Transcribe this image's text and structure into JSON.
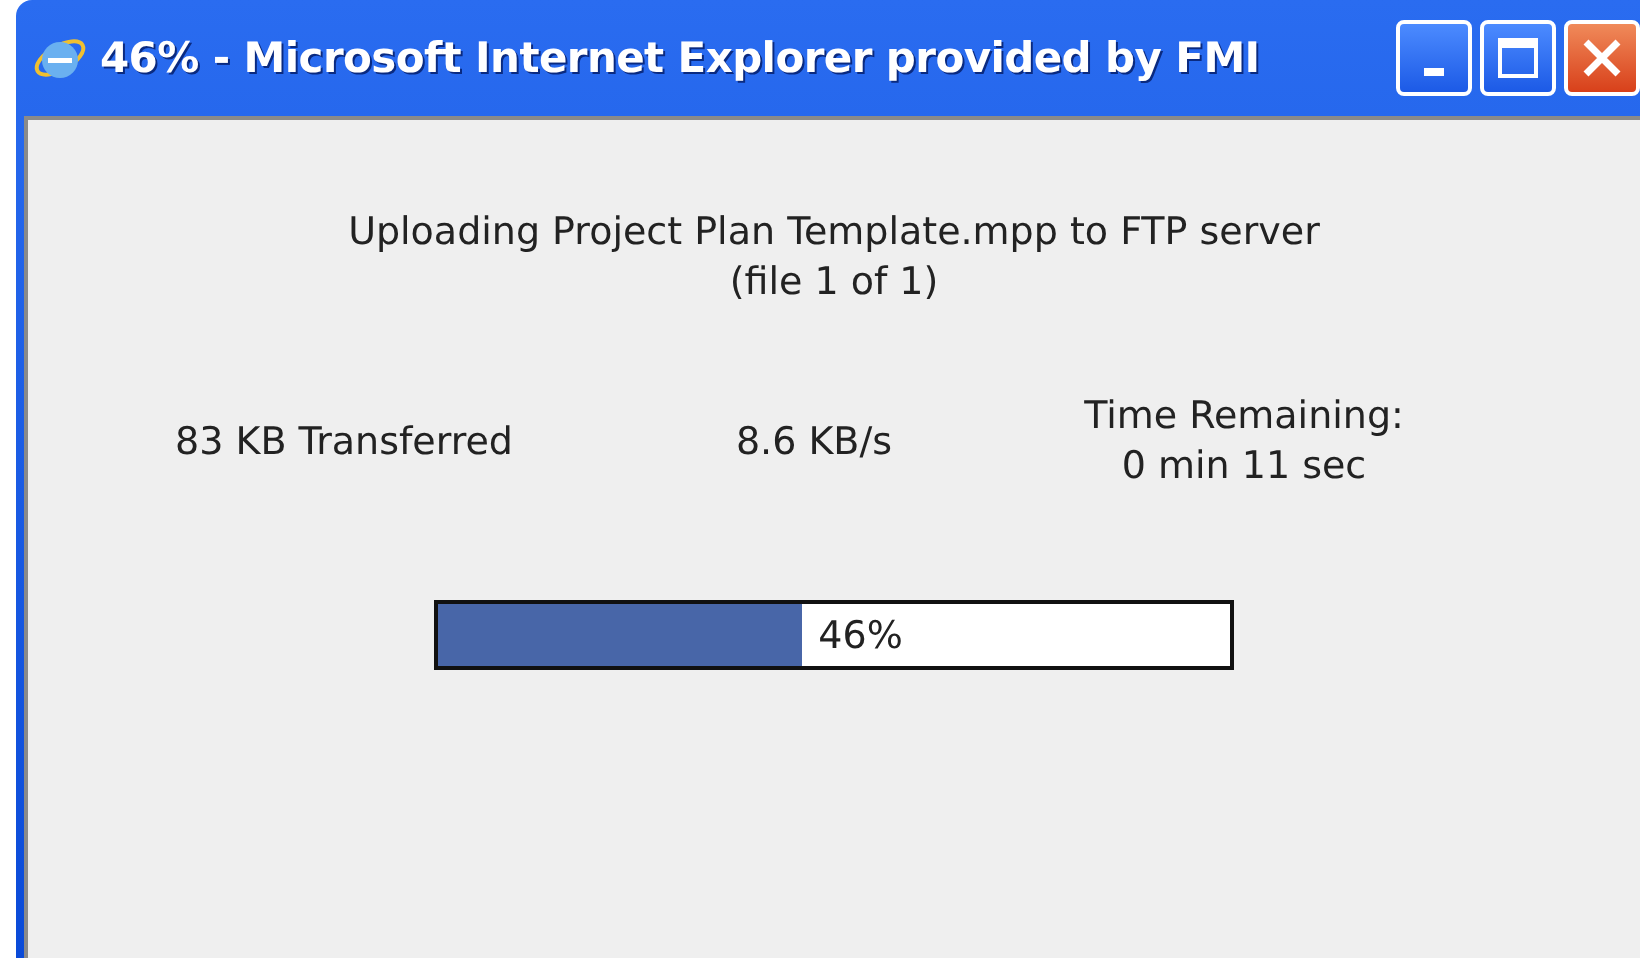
{
  "window": {
    "title": "46% - Microsoft Internet Explorer provided by FMI"
  },
  "message": {
    "line_1": "Uploading Project Plan Template.mpp to FTP server",
    "line_2": "(file 1 of 1)"
  },
  "stats": {
    "transferred": "83 KB Transferred",
    "rate": "8.6 KB/s",
    "time_label": "Time Remaining:",
    "time_value": "0 min 11 sec"
  },
  "progress": {
    "level": 0.46,
    "label": "46%"
  }
}
